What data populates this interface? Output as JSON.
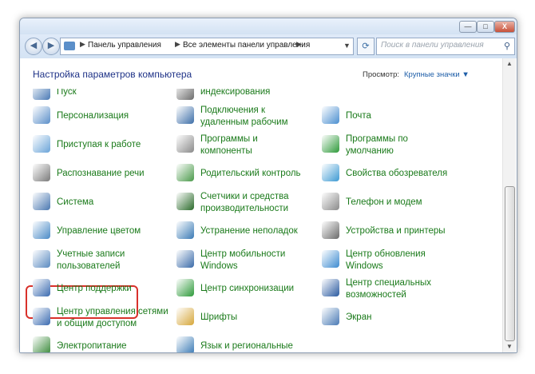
{
  "window": {
    "controls": {
      "minimize": "—",
      "maximize": "□",
      "close": "X"
    }
  },
  "address": {
    "back_icon": "back-arrow",
    "forward_icon": "forward-arrow",
    "path": [
      "Панель управления",
      "Все элементы панели управления"
    ],
    "search_placeholder": "Поиск в панели управления"
  },
  "header": {
    "title": "Настройка параметров компьютера",
    "view_label": "Просмотр:",
    "view_value": "Крупные значки ▼"
  },
  "items": [
    {
      "label": "Пуск",
      "color": "#4a7ab5"
    },
    {
      "label": "индексирования",
      "color": "#6b6b6b"
    },
    {
      "label": "Персонализация",
      "color": "#5b8fc9"
    },
    {
      "label": "Подключения к удаленным рабочим",
      "lines": [
        "Подключения к",
        "удаленным рабочим"
      ],
      "color": "#3d6ea8"
    },
    {
      "label": "Почта",
      "color": "#4b8fd0"
    },
    {
      "label": "Приступая к работе",
      "color": "#6aa4d8"
    },
    {
      "label": "Программы и компоненты",
      "lines": [
        "Программы и",
        "компоненты"
      ],
      "color": "#8a8a8a"
    },
    {
      "label": "Программы по умолчанию",
      "lines": [
        "Программы по",
        "умолчанию"
      ],
      "color": "#2e9a3a"
    },
    {
      "label": "Распознавание речи",
      "color": "#7a7a7a"
    },
    {
      "label": "Родительский контроль",
      "color": "#4a9a4a"
    },
    {
      "label": "Свойства обозревателя",
      "color": "#3d9ad3"
    },
    {
      "label": "Система",
      "color": "#4a77b0"
    },
    {
      "label": "Счетчики и средства производительности",
      "lines": [
        "Счетчики и средства",
        "производительности"
      ],
      "color": "#2a6a2a"
    },
    {
      "label": "Телефон и модем",
      "color": "#8a8a8a"
    },
    {
      "label": "Управление цветом",
      "color": "#4a8ac6"
    },
    {
      "label": "Устранение неполадок",
      "color": "#3a7ab5"
    },
    {
      "label": "Устройства и принтеры",
      "color": "#6a6a6a"
    },
    {
      "label": "Учетные записи пользователей",
      "lines": [
        "Учетные записи",
        "пользователей"
      ],
      "color": "#5a8ac0"
    },
    {
      "label": "Центр мобильности Windows",
      "lines": [
        "Центр мобильности",
        "Windows"
      ],
      "color": "#3a6aa8"
    },
    {
      "label": "Центр обновления Windows",
      "lines": [
        "Центр обновления",
        "Windows"
      ],
      "color": "#3d8bd0"
    },
    {
      "label": "Центр поддержки",
      "color": "#3a6ab0"
    },
    {
      "label": "Центр синхронизации",
      "color": "#2e9a3a"
    },
    {
      "label": "Центр специальных возможностей",
      "lines": [
        "Центр специальных",
        "возможностей"
      ],
      "color": "#2a5aa0"
    },
    {
      "label": "Центр управления сетями и общим доступом",
      "lines": [
        "Центр управления сетями",
        "и общим доступом"
      ],
      "color": "#3a6ab0"
    },
    {
      "label": "Шрифты",
      "color": "#d6a73a"
    },
    {
      "label": "Экран",
      "color": "#4a7ab5"
    },
    {
      "label": "Электропитание",
      "color": "#3a8a3a"
    },
    {
      "label": "Язык и региональные",
      "color": "#3a7ab5"
    }
  ]
}
